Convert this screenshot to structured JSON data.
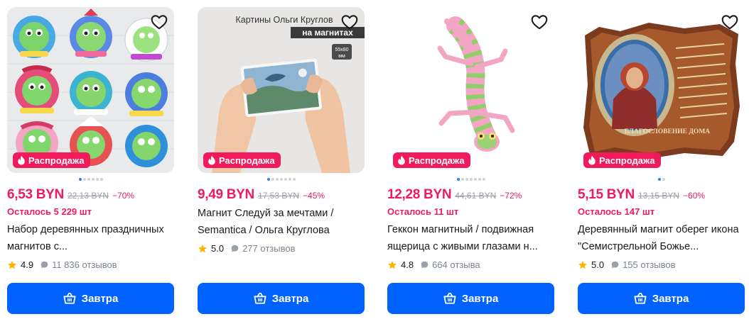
{
  "products": [
    {
      "price": "6,53 BYN",
      "old_price": "22,13 BYN",
      "discount": "−70%",
      "stock": "Осталось 5 229 шт",
      "title": "Набор деревянных праздничных магнитов с...",
      "rating": "4.9",
      "reviews": "11 836 отзывов",
      "sale_label": "Распродажа",
      "cart_label": "Завтра",
      "image_icon": "christmas-snake-magnets-image",
      "image_text": {},
      "dots_total": 6,
      "dots_active": 1
    },
    {
      "price": "9,49 BYN",
      "old_price": "17,53 BYN",
      "discount": "−45%",
      "stock": "",
      "title": "Магнит Следуй за мечтами / Semantica / Ольга Круглова",
      "rating": "5.0",
      "reviews": "277 отзывов",
      "sale_label": "Распродажа",
      "cart_label": "Завтра",
      "image_icon": "painting-magnet-in-hands-image",
      "image_text": {
        "caption": "Картины Ольги Круглов",
        "tag": "на магнитах",
        "size_top": "55x80",
        "size_bottom": "мм"
      },
      "dots_total": 7,
      "dots_active": 1
    },
    {
      "price": "12,28 BYN",
      "old_price": "44,61 BYN",
      "discount": "−72%",
      "stock": "Осталось 11 шт",
      "title": "Геккон магнитный / подвижная ящерица с живыми глазами н...",
      "rating": "4.8",
      "reviews": "664 отзыва",
      "sale_label": "Распродажа",
      "cart_label": "Завтра",
      "image_icon": "gecko-magnet-image",
      "image_text": {},
      "dots_total": 7,
      "dots_active": 1
    },
    {
      "price": "5,15 BYN",
      "old_price": "13,15 BYN",
      "discount": "−60%",
      "stock": "Осталось 147 шт",
      "title": "Деревянный магнит оберег икона \"Семистрельной Божье...",
      "rating": "5.0",
      "reviews": "155 отзывов",
      "sale_label": "Распродажа",
      "cart_label": "Завтра",
      "image_icon": "icon-magnet-image",
      "image_text": {
        "banner": "БЛАГОСЛОВЕНИЕ ДОМА"
      },
      "dots_total": 2,
      "dots_active": 1
    }
  ],
  "colors": {
    "accent_red": "#f01a5d",
    "button_blue": "#0062ff",
    "star_yellow": "#ffb400",
    "muted_gray": "#9aa0a9"
  }
}
